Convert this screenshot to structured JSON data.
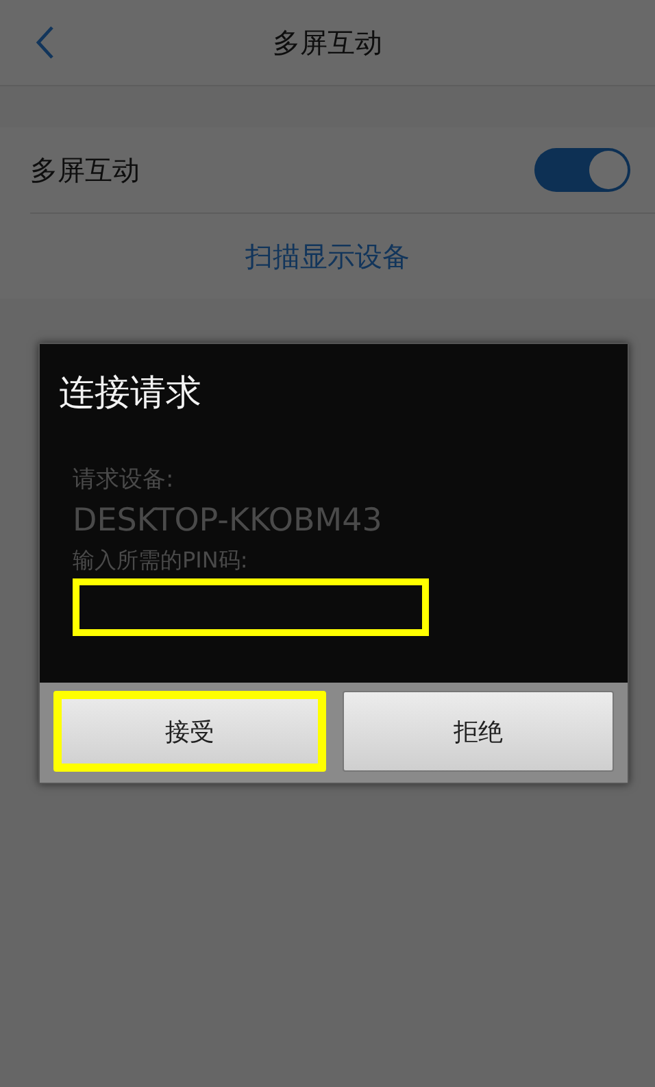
{
  "header": {
    "title": "多屏互动"
  },
  "settings": {
    "label": "多屏互动",
    "on": true
  },
  "scan_button": {
    "label": "扫描显示设备"
  },
  "dialog": {
    "title": "连接请求",
    "requester_label": "请求设备:",
    "requester_name": "DESKTOP-KKOBM43",
    "pin_label": "输入所需的PIN码:",
    "pin_input": {
      "highlighted": true
    },
    "buttons": [
      {
        "label": "接受",
        "highlighted": true
      },
      {
        "label": "拒绝",
        "highlighted": false
      }
    ]
  }
}
